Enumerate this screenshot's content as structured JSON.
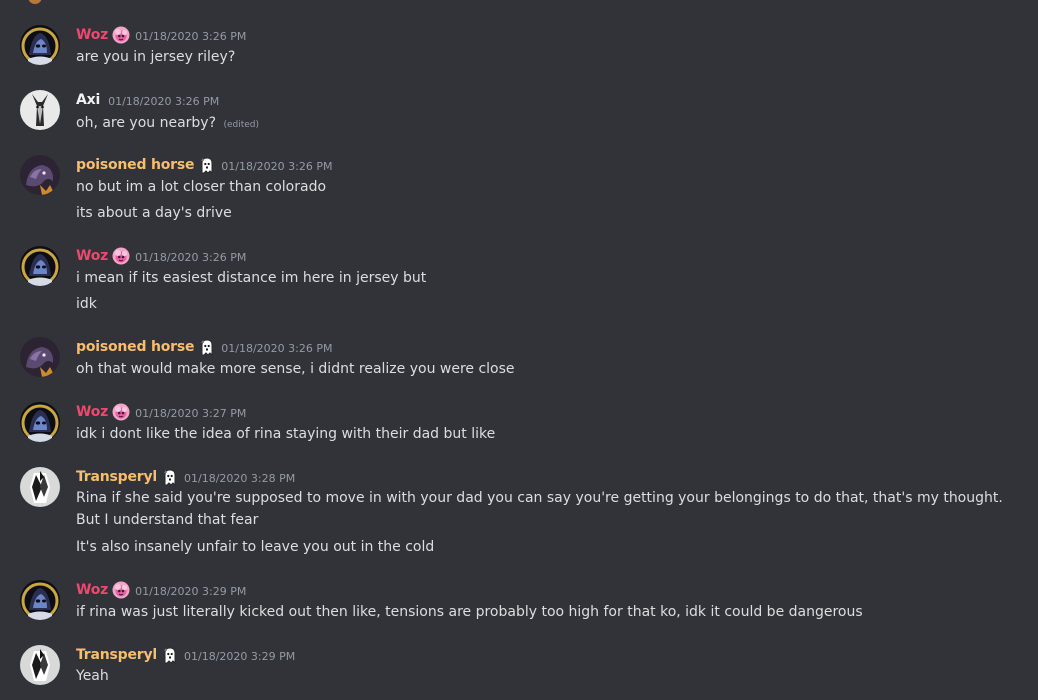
{
  "colors": {
    "background": "#313338",
    "text": "#dbdee1",
    "timestamp": "#949ba4",
    "woz": "#f0476f",
    "axi": "#f2f3f5",
    "poisoned_horse": "#f9bd6b",
    "transperyl": "#f9bd6b"
  },
  "messages": [
    {
      "username": "Woz",
      "badge": "pink-pony-emoji-icon",
      "timestamp": "01/18/2020 3:26 PM",
      "lines": [
        "are you in jersey riley?"
      ]
    },
    {
      "username": "Axi",
      "timestamp": "01/18/2020 3:26 PM",
      "lines": [
        "oh, are you nearby?"
      ],
      "edited": "(edited)"
    },
    {
      "username": "poisoned horse",
      "badge": "ghost-emoji-icon",
      "timestamp": "01/18/2020 3:26 PM",
      "lines": [
        "no but im a lot closer than colorado",
        "its about a day's drive"
      ]
    },
    {
      "username": "Woz",
      "badge": "pink-pony-emoji-icon",
      "timestamp": "01/18/2020 3:26 PM",
      "lines": [
        "i mean if its easiest distance im here in jersey but",
        "idk"
      ]
    },
    {
      "username": "poisoned horse",
      "badge": "ghost-emoji-icon",
      "timestamp": "01/18/2020 3:26 PM",
      "lines": [
        "oh that would make more sense, i didnt realize you were close"
      ]
    },
    {
      "username": "Woz",
      "badge": "pink-pony-emoji-icon",
      "timestamp": "01/18/2020 3:27 PM",
      "lines": [
        "idk i dont like the idea of rina staying with their dad but like"
      ]
    },
    {
      "username": "Transperyl",
      "badge": "ghost-emoji-icon",
      "timestamp": "01/18/2020 3:28 PM",
      "lines": [
        "Rina if she said you're supposed to move in with your dad you can say you're getting your belongings to do that, that's my thought. But I understand that fear",
        "It's also insanely unfair to leave you out in the cold"
      ]
    },
    {
      "username": "Woz",
      "badge": "pink-pony-emoji-icon",
      "timestamp": "01/18/2020 3:29 PM",
      "lines": [
        "if rina was just literally kicked out then like, tensions are probably too high for that ko, idk it could be dangerous"
      ]
    },
    {
      "username": "Transperyl",
      "badge": "ghost-emoji-icon",
      "timestamp": "01/18/2020 3:29 PM",
      "lines": [
        "Yeah"
      ]
    }
  ]
}
